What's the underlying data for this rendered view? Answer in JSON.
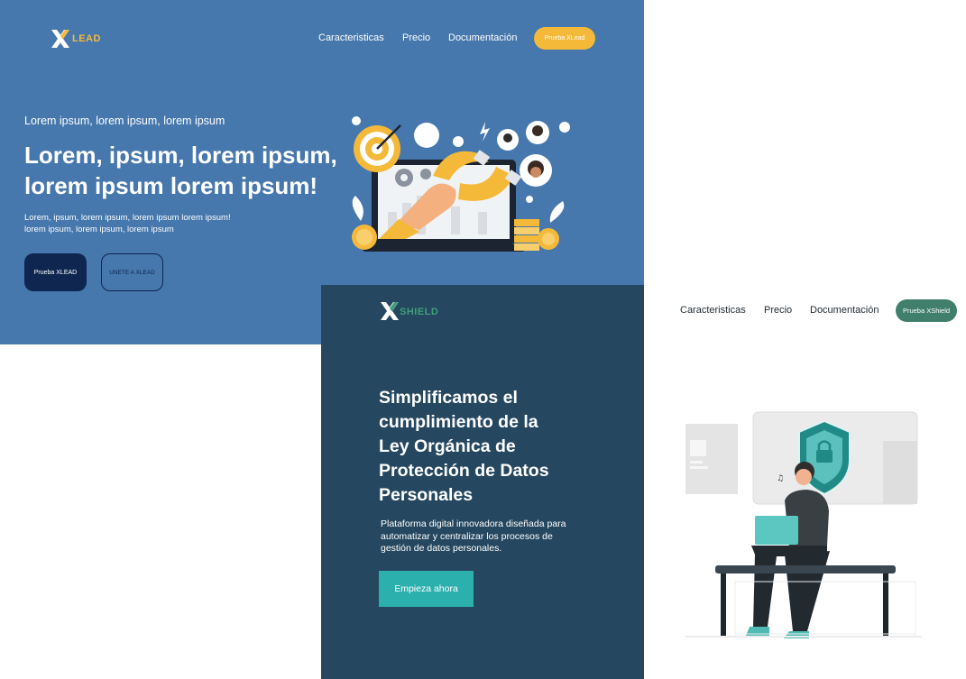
{
  "xlead": {
    "logo_text": "LEAD",
    "nav": [
      "Caracteristicas",
      "Precio",
      "Documentación"
    ],
    "cta_label": "Prueba XLead",
    "kicker": "Lorem ipsum, lorem ipsum, lorem ipsum",
    "headline_line1": "Lorem, ipsum, lorem ipsum,",
    "headline_line2": "lorem ipsum lorem ipsum!",
    "desc_line1": "Lorem, ipsum, lorem ipsum, lorem ipsum lorem ipsum!",
    "desc_line2": "lorem ipsum, lorem ipsum, lorem ipsum",
    "btn_primary": "Prueba XLEAD",
    "btn_secondary": "UNETE A XLEAD",
    "colors": {
      "background": "#4677ad",
      "accent": "#f5b93a",
      "dark": "#0e2650"
    }
  },
  "xshield": {
    "logo_text": "SHIELD",
    "nav": [
      "Caracteristicas",
      "Precio",
      "Documentación"
    ],
    "cta_label": "Prueba XShield",
    "headline_lines": [
      "Simplificamos el",
      "cumplimiento de la",
      "Ley Orgánica de",
      "Protección de Datos",
      "Personales"
    ],
    "desc_lines": [
      "Plataforma digital innovadora diseñada para",
      "automatizar y centralizar los procesos de",
      "gestión de datos personales."
    ],
    "start_label": "Empieza ahora",
    "colors": {
      "background": "#25475f",
      "accent": "#2cb0ae",
      "nav_button": "#3f7f6b"
    }
  },
  "icons": [
    "x-logo-icon",
    "magnet-marketing-illustration",
    "security-shield-illustration"
  ]
}
